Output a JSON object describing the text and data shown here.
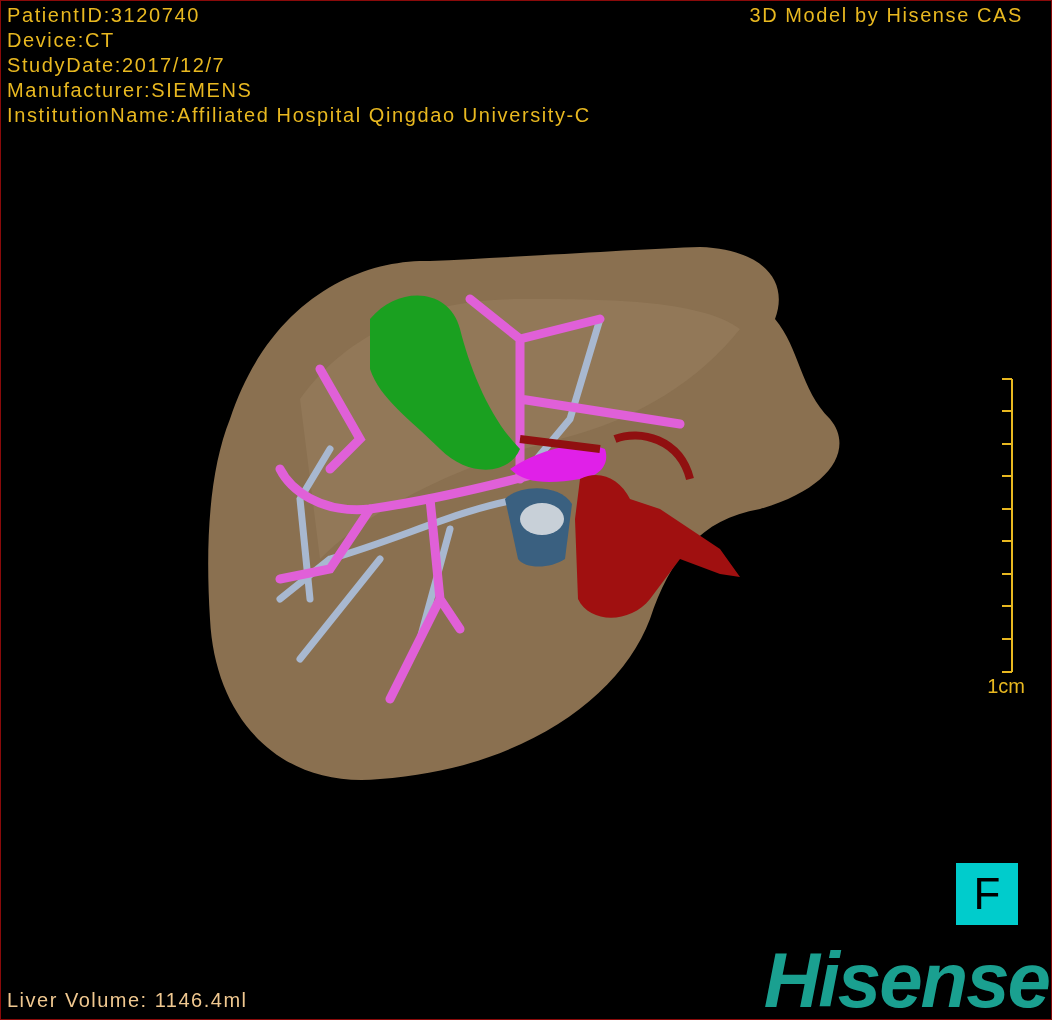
{
  "info_lines": [
    "PatientID:3120740",
    "Device:CT",
    "StudyDate:2017/12/7",
    "Manufacturer:SIEMENS",
    "InstitutionName:Affiliated Hospital Qingdao University-C"
  ],
  "credit": "3D Model by Hisense CAS",
  "scale": {
    "label": "1cm"
  },
  "volume": "Liver Volume: 1146.4ml",
  "orientation_marker": "F",
  "logo": "Hisense"
}
